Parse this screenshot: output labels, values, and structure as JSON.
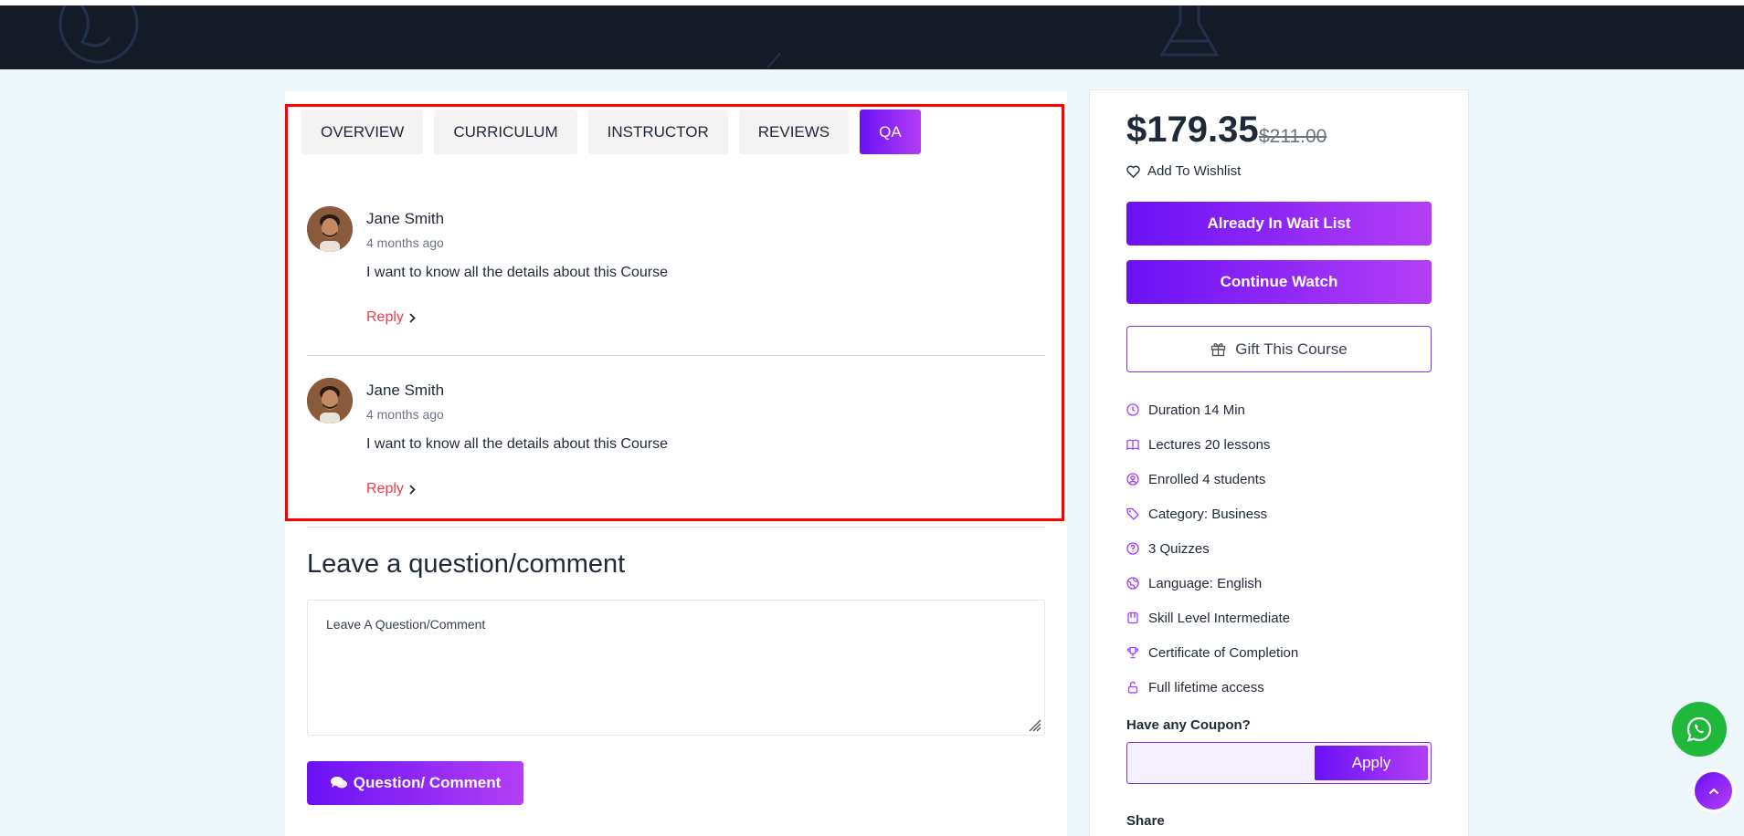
{
  "tabs": [
    {
      "label": "OVERVIEW"
    },
    {
      "label": "CURRICULUM"
    },
    {
      "label": "INSTRUCTOR"
    },
    {
      "label": "REVIEWS"
    },
    {
      "label": "QA",
      "active": true
    }
  ],
  "qa": {
    "comments": [
      {
        "author": "Jane Smith",
        "time": "4 months ago",
        "text": "I want to know all the details about this Course",
        "reply_label": "Reply"
      },
      {
        "author": "Jane Smith",
        "time": "4 months ago",
        "text": "I want to know all the details about this Course",
        "reply_label": "Reply"
      }
    ],
    "form_heading": "Leave a question/comment",
    "textarea_placeholder": "Leave A Question/Comment",
    "submit_label": "Question/ Comment"
  },
  "sidebar": {
    "price": "$179.35",
    "old_price": "$211.00",
    "wishlist_label": "Add To Wishlist",
    "waitlist_label": "Already In Wait List",
    "continue_label": "Continue Watch",
    "gift_label": "Gift This Course",
    "info": [
      {
        "icon": "clock-icon",
        "text": "Duration 14 Min"
      },
      {
        "icon": "book-icon",
        "text": "Lectures 20 lessons"
      },
      {
        "icon": "user-circle-icon",
        "text": "Enrolled 4 students"
      },
      {
        "icon": "tag-icon",
        "text": "Category: Business"
      },
      {
        "icon": "question-icon",
        "text": "3 Quizzes"
      },
      {
        "icon": "globe-icon",
        "text": "Language: English"
      },
      {
        "icon": "level-icon",
        "text": "Skill Level Intermediate"
      },
      {
        "icon": "trophy-icon",
        "text": "Certificate of Completion"
      },
      {
        "icon": "lock-open-icon",
        "text": "Full lifetime access"
      }
    ],
    "coupon_label": "Have any Coupon?",
    "coupon_value": "",
    "apply_label": "Apply",
    "share_label": "Share"
  },
  "colors": {
    "accent_start": "#6a11f5",
    "accent_end": "#b43ef5",
    "reply": "#ef3b4c",
    "header": "#141b27",
    "page_bg": "#eef7fc",
    "whatsapp": "#1fb83a"
  }
}
